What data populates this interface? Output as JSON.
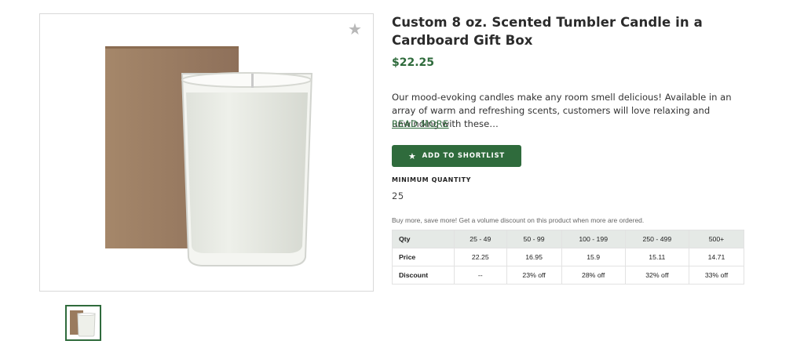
{
  "product": {
    "title": "Custom 8 oz. Scented Tumbler Candle in a Cardboard Gift Box",
    "price": "$22.25",
    "description": "Our mood-evoking candles make any room smell delicious! Available in an array of warm and refreshing scents, customers will love relaxing and unwinding with these…",
    "read_more": "READ MORE",
    "add_to_shortlist": "ADD TO SHORTLIST",
    "min_quantity_label": "MINIMUM QUANTITY",
    "min_quantity_value": "25",
    "volume_note": "Buy more, save more! Get a volume discount on this product when more are ordered."
  },
  "pricing_table": {
    "qty_header": "Qty",
    "price_header": "Price",
    "discount_header": "Discount",
    "tiers": [
      {
        "qty": "25 - 49",
        "price": "22.25",
        "discount": "--"
      },
      {
        "qty": "50 - 99",
        "price": "16.95",
        "discount": "23% off"
      },
      {
        "qty": "100 - 199",
        "price": "15.9",
        "discount": "28% off"
      },
      {
        "qty": "250 - 499",
        "price": "15.11",
        "discount": "32% off"
      },
      {
        "qty": "500+",
        "price": "14.71",
        "discount": "33% off"
      }
    ]
  },
  "icons": {
    "favorite": "star-icon",
    "button": "star-icon"
  },
  "colors": {
    "accent": "#2f6b3c",
    "table_header_bg": "#e5e9e6"
  }
}
